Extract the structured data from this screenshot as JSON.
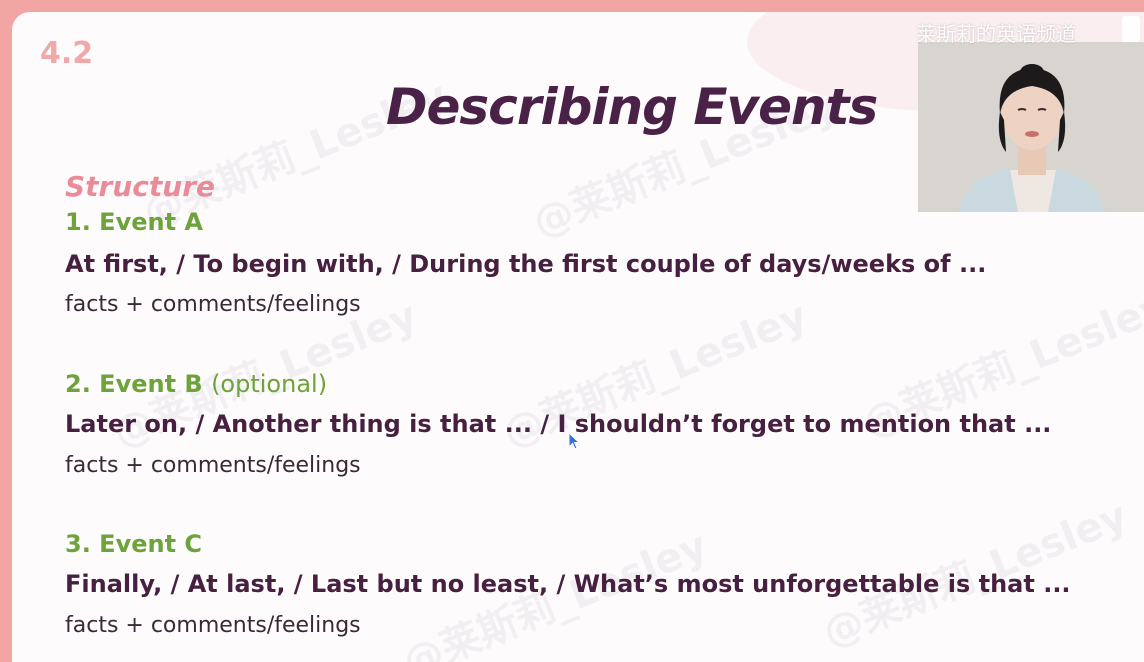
{
  "slide": {
    "number": "4.2",
    "title": "Describing Events",
    "structure_label": "Structure",
    "events": [
      {
        "heading": "1. Event A",
        "optional": "",
        "phrases": "At first, / To begin with, / During the first couple of days/weeks of ...",
        "note": "facts + comments/feelings"
      },
      {
        "heading": "2. Event B",
        "optional": "(optional)",
        "phrases": "Later on, / Another thing is that ... / I shouldn’t forget to mention that ...",
        "note": "facts + comments/feelings"
      },
      {
        "heading": "3. Event C",
        "optional": "",
        "phrases": "Finally, / At last, / Last but no least, / What’s most unforgettable is that ...",
        "note": "facts + comments/feelings"
      }
    ],
    "watermark": "@莱斯莉_Lesley"
  },
  "overlay": {
    "channel_label": "莱斯莉的英语频道"
  },
  "colors": {
    "frame": "#f2a6a3",
    "title": "#4a2147",
    "event_heading": "#6ea23a",
    "structure": "#e98b98"
  }
}
